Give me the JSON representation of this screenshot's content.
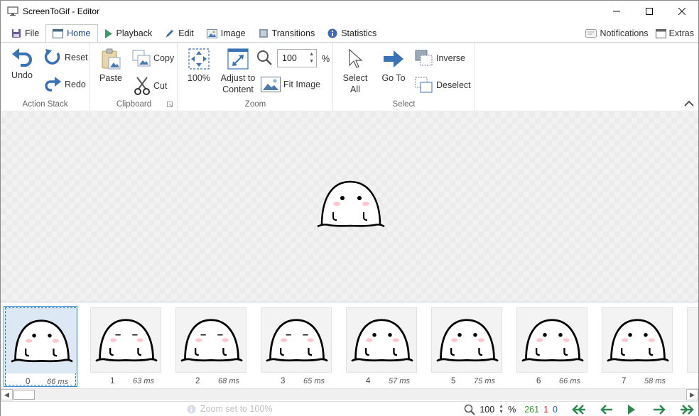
{
  "window": {
    "title": "ScreenToGif - Editor"
  },
  "tabs": [
    {
      "label": "File",
      "icon": "save-icon"
    },
    {
      "label": "Home",
      "icon": "home-icon",
      "active": true
    },
    {
      "label": "Playback",
      "icon": "play-icon"
    },
    {
      "label": "Edit",
      "icon": "pencil-icon"
    },
    {
      "label": "Image",
      "icon": "image-icon"
    },
    {
      "label": "Transitions",
      "icon": "transitions-icon"
    },
    {
      "label": "Statistics",
      "icon": "info-icon"
    }
  ],
  "tab_right": {
    "notifications": "Notifications",
    "extras": "Extras"
  },
  "ribbon": {
    "action_stack": {
      "label": "Action Stack",
      "undo": "Undo",
      "reset": "Reset",
      "redo": "Redo"
    },
    "clipboard": {
      "label": "Clipboard",
      "paste": "Paste",
      "copy": "Copy",
      "cut": "Cut"
    },
    "zoom": {
      "label": "Zoom",
      "zoom_100": "100%",
      "adjust_line1": "Adjust to",
      "adjust_line2": "Content",
      "fit_image": "Fit Image",
      "zoom_value": "100",
      "percent": "%"
    },
    "select": {
      "label": "Select",
      "select_all_line1": "Select",
      "select_all_line2": "All",
      "go_to": "Go To",
      "inverse": "Inverse",
      "deselect": "Deselect"
    }
  },
  "frames": [
    {
      "index": "0",
      "delay": "66 ms",
      "selected": true
    },
    {
      "index": "1",
      "delay": "63 ms"
    },
    {
      "index": "2",
      "delay": "68 ms"
    },
    {
      "index": "3",
      "delay": "65 ms"
    },
    {
      "index": "4",
      "delay": "57 ms"
    },
    {
      "index": "5",
      "delay": "75 ms"
    },
    {
      "index": "6",
      "delay": "66 ms"
    },
    {
      "index": "7",
      "delay": "58 ms"
    }
  ],
  "status": {
    "message": "Zoom set to 100%",
    "zoom_value": "100",
    "percent": "%",
    "total_frames": "261",
    "selected_count": "1",
    "current_frame": "0"
  },
  "colors": {
    "accent": "#3c8fd8",
    "frames_total": "#2e9a2e",
    "selected_count": "#d02020",
    "current_frame": "#1a5fc0",
    "nav_arrows": "#2d8a4e"
  }
}
